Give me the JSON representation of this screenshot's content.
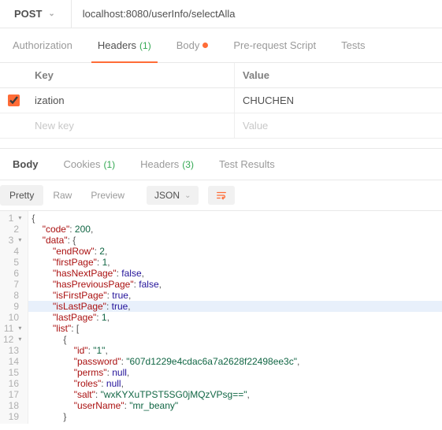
{
  "request": {
    "method": "POST",
    "url": "localhost:8080/userInfo/selectAlla"
  },
  "reqTabs": {
    "authorization": "Authorization",
    "headers": "Headers",
    "headersCount": "(1)",
    "body": "Body",
    "prerequest": "Pre-request Script",
    "tests": "Tests"
  },
  "kv": {
    "keyHeader": "Key",
    "valueHeader": "Value",
    "row1": {
      "key": "ization",
      "value": "CHUCHEN"
    },
    "placeholderKey": "New key",
    "placeholderValue": "Value"
  },
  "respTabs": {
    "body": "Body",
    "cookies": "Cookies",
    "cookiesCount": "(1)",
    "headers": "Headers",
    "headersCount": "(3)",
    "testResults": "Test Results"
  },
  "fmt": {
    "pretty": "Pretty",
    "raw": "Raw",
    "preview": "Preview",
    "json": "JSON"
  },
  "code": {
    "l1": "{",
    "l2": "    \"code\": 200,",
    "l3": "    \"data\": {",
    "l4": "        \"endRow\": 2,",
    "l5": "        \"firstPage\": 1,",
    "l6": "        \"hasNextPage\": false,",
    "l7": "        \"hasPreviousPage\": false,",
    "l8": "        \"isFirstPage\": true,",
    "l9": "        \"isLastPage\": true,",
    "l10": "        \"lastPage\": 1,",
    "l11": "        \"list\": [",
    "l12": "            {",
    "l13": "                \"id\": \"1\",",
    "l14": "                \"password\": \"607d1229e4cdac6a7a2628f22498ee3c\",",
    "l15": "                \"perms\": null,",
    "l16": "                \"roles\": null,",
    "l17": "                \"salt\": \"wxKYXuTPST5SG0jMQzVPsg==\",",
    "l18": "                \"userName\": \"mr_beany\"",
    "l19": "            }"
  }
}
